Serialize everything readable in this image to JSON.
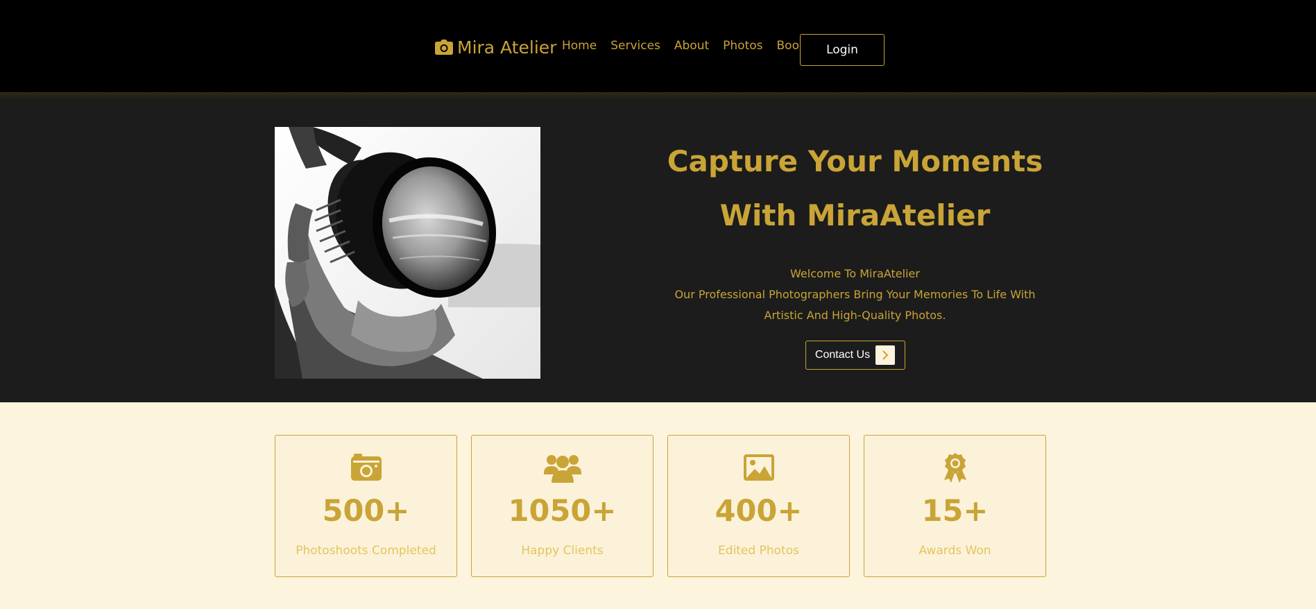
{
  "brand": {
    "name": "Mira Atelier",
    "icon": "camera-icon"
  },
  "nav": {
    "links": [
      "Home",
      "Services",
      "About",
      "Photos",
      "Book"
    ],
    "login_label": "Login"
  },
  "hero": {
    "title_line1": "Capture Your Moments",
    "title_line2": "With MiraAtelier",
    "welcome": "Welcome To MiraAtelier",
    "description": "Our Professional Photographers Bring Your Memories To Life With Artistic And High-Quality Photos.",
    "contact_label": "Contact Us"
  },
  "stats": [
    {
      "icon": "camera-retro-icon",
      "value": "500+",
      "label": "Photoshoots Completed"
    },
    {
      "icon": "users-icon",
      "value": "1050+",
      "label": "Happy Clients"
    },
    {
      "icon": "image-icon",
      "value": "400+",
      "label": "Edited Photos"
    },
    {
      "icon": "award-icon",
      "value": "15+",
      "label": "Awards Won"
    }
  ],
  "colors": {
    "accent": "#c9a436",
    "nav_bg": "#000000",
    "hero_bg": "#1c1c1c",
    "section_bg": "#fcf4dd",
    "stat_label": "#e3c55b"
  }
}
